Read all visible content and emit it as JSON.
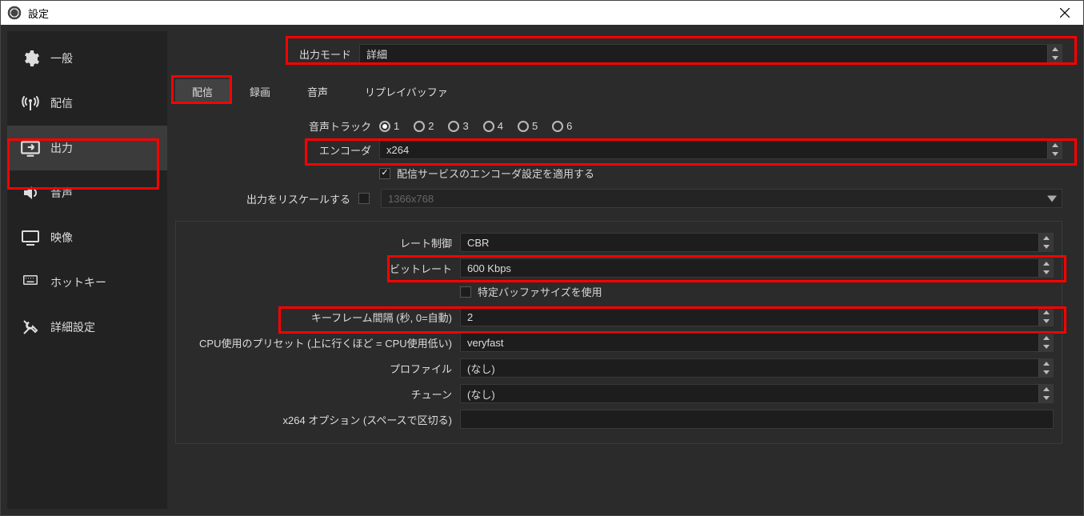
{
  "window": {
    "title": "設定"
  },
  "sidebar": {
    "items": [
      {
        "label": "一般"
      },
      {
        "label": "配信"
      },
      {
        "label": "出力"
      },
      {
        "label": "音声"
      },
      {
        "label": "映像"
      },
      {
        "label": "ホットキー"
      },
      {
        "label": "詳細設定"
      }
    ]
  },
  "output_mode": {
    "label": "出力モード",
    "value": "詳細"
  },
  "tabs": [
    {
      "label": "配信"
    },
    {
      "label": "録画"
    },
    {
      "label": "音声"
    },
    {
      "label": "リプレイバッファ"
    }
  ],
  "audio_track": {
    "label": "音声トラック",
    "options": [
      "1",
      "2",
      "3",
      "4",
      "5",
      "6"
    ],
    "selected": "1"
  },
  "encoder": {
    "label": "エンコーダ",
    "value": "x264"
  },
  "apply_service": {
    "label": "配信サービスのエンコーダ設定を適用する",
    "checked": true
  },
  "rescale": {
    "label": "出力をリスケールする",
    "checked": false,
    "value": "1366x768"
  },
  "rate_control": {
    "label": "レート制御",
    "value": "CBR"
  },
  "bitrate": {
    "label": "ビットレート",
    "value": "600 Kbps"
  },
  "buffer_size": {
    "label": "特定バッファサイズを使用",
    "checked": false
  },
  "keyframe": {
    "label": "キーフレーム間隔 (秒, 0=自動)",
    "value": "2"
  },
  "cpu_preset": {
    "label": "CPU使用のプリセット (上に行くほど = CPU使用低い)",
    "value": "veryfast"
  },
  "profile": {
    "label": "プロファイル",
    "value": "(なし)"
  },
  "tune": {
    "label": "チューン",
    "value": "(なし)"
  },
  "x264_opts": {
    "label": "x264 オプション (スペースで区切る)",
    "value": ""
  }
}
